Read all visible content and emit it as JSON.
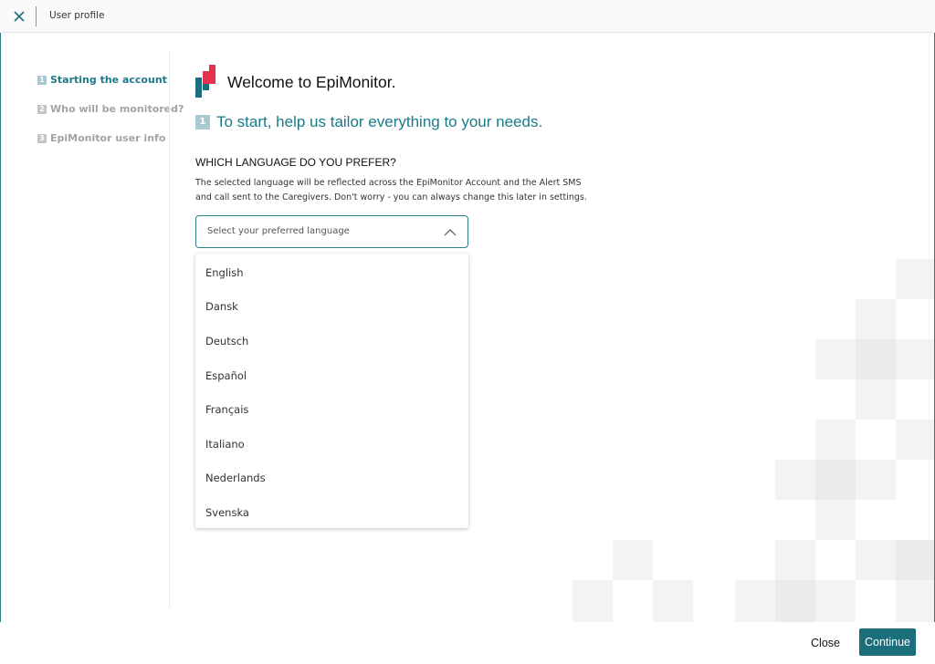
{
  "header": {
    "title": "User profile",
    "close_icon": "close-icon"
  },
  "sidebar": {
    "steps": [
      {
        "num": "1",
        "label": "Starting the account",
        "active": true
      },
      {
        "num": "2",
        "label": "Who will be monitored?",
        "active": false
      },
      {
        "num": "3",
        "label": "EpiMonitor user info",
        "active": false
      }
    ]
  },
  "main": {
    "welcome": "Welcome to EpiMonitor.",
    "step_badge": "1",
    "subtitle": "To start, help us tailor everything to your needs.",
    "question": "WHICH LANGUAGE DO YOU PREFER?",
    "description_line1": "The selected language will be reflected across the EpiMonitor Account and the Alert SMS",
    "description_line2": "and call sent to the Caregivers. Don't worry - you can always change this later in settings.",
    "select": {
      "placeholder": "Select your preferred language",
      "icon": "chevron-up-icon"
    },
    "options": [
      "English",
      "Dansk",
      "Deutsch",
      "Español",
      "Français",
      "Italiano",
      "Nederlands",
      "Svenska"
    ]
  },
  "footer": {
    "close_label": "Close",
    "continue_label": "Continue"
  },
  "colors": {
    "accent": "#1b7a8a",
    "button": "#1b6e7c",
    "logo_red": "#e3344f",
    "logo_teal": "#1b6e7c"
  }
}
